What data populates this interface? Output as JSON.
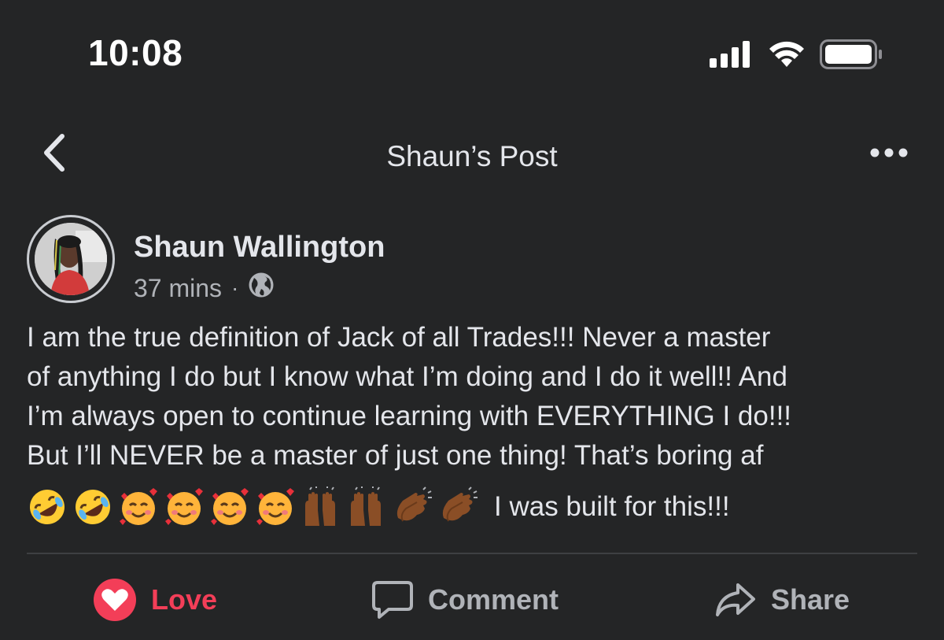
{
  "status_bar": {
    "time": "10:08"
  },
  "nav": {
    "title": "Shaun’s Post"
  },
  "post": {
    "author": "Shaun Wallington",
    "time_ago": "37 mins",
    "separator": "·",
    "privacy_icon": "globe-icon",
    "text_lines": [
      "I am the true definition of Jack of all Trades!!! Never a master",
      "of anything I do but I know what I’m doing and I do it well!! And",
      "I’m always open to continue learning with EVERYTHING I do!!!",
      "But I’ll NEVER be a master of just one thing! That’s boring af"
    ],
    "emojis": [
      "rofl",
      "rofl",
      "smiling-face-with-hearts",
      "smiling-face-with-hearts",
      "smiling-face-with-hearts",
      "smiling-face-with-hearts",
      "raising-hands",
      "raising-hands",
      "clapping-hands",
      "clapping-hands"
    ],
    "emoji_text": "I was built for this!!!"
  },
  "actions": {
    "love_label": "Love",
    "comment_label": "Comment",
    "share_label": "Share"
  },
  "colors": {
    "background": "#242526",
    "text_primary": "#e4e6eb",
    "text_secondary": "#b0b3b8",
    "love_red": "#f33e58",
    "divider": "#3e4042"
  }
}
